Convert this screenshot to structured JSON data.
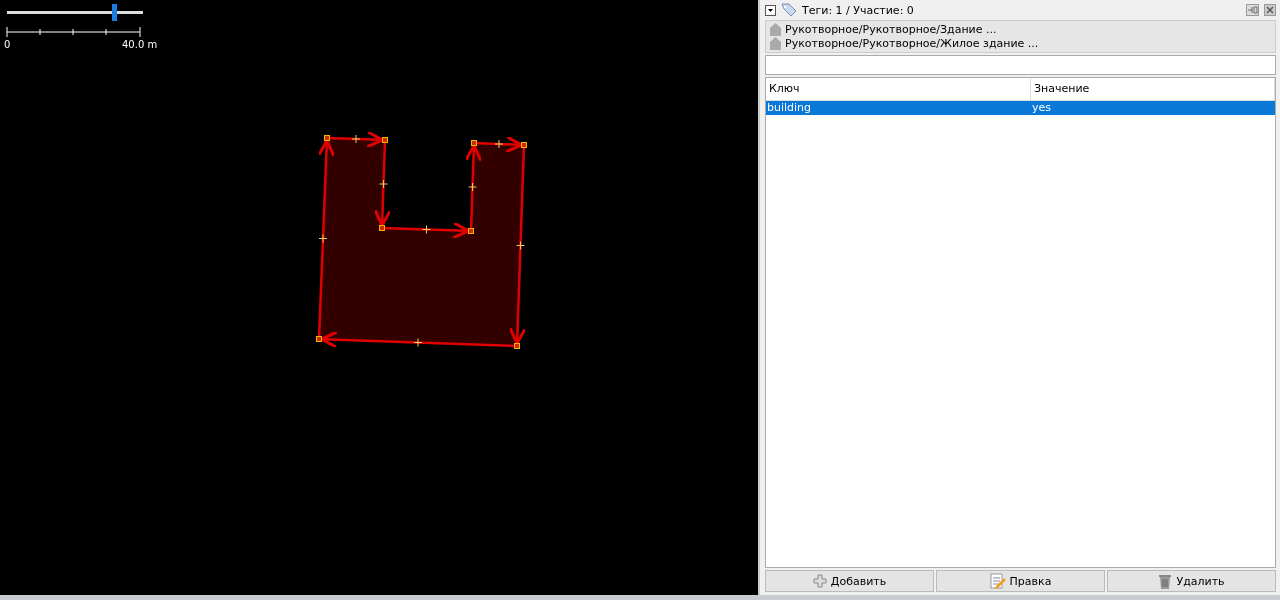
{
  "map": {
    "zoom_slider": {
      "level": 0.79
    },
    "scale": {
      "start": "0",
      "end": "40.0 m"
    }
  },
  "tags_panel": {
    "title": "Теги: 1 / Участие: 0",
    "presets": [
      {
        "label": "Рукотворное/Рукотворное/Здание ..."
      },
      {
        "label": "Рукотворное/Рукотворное/Жилое здание ..."
      }
    ],
    "columns": [
      "Ключ",
      "Значение"
    ],
    "rows": [
      {
        "key": "building",
        "value": "yes",
        "selected": true
      }
    ],
    "buttons": [
      {
        "kind": "add",
        "label": "Добавить"
      },
      {
        "kind": "edit",
        "label": "Правка"
      },
      {
        "kind": "delete",
        "label": "Удалить"
      }
    ]
  }
}
